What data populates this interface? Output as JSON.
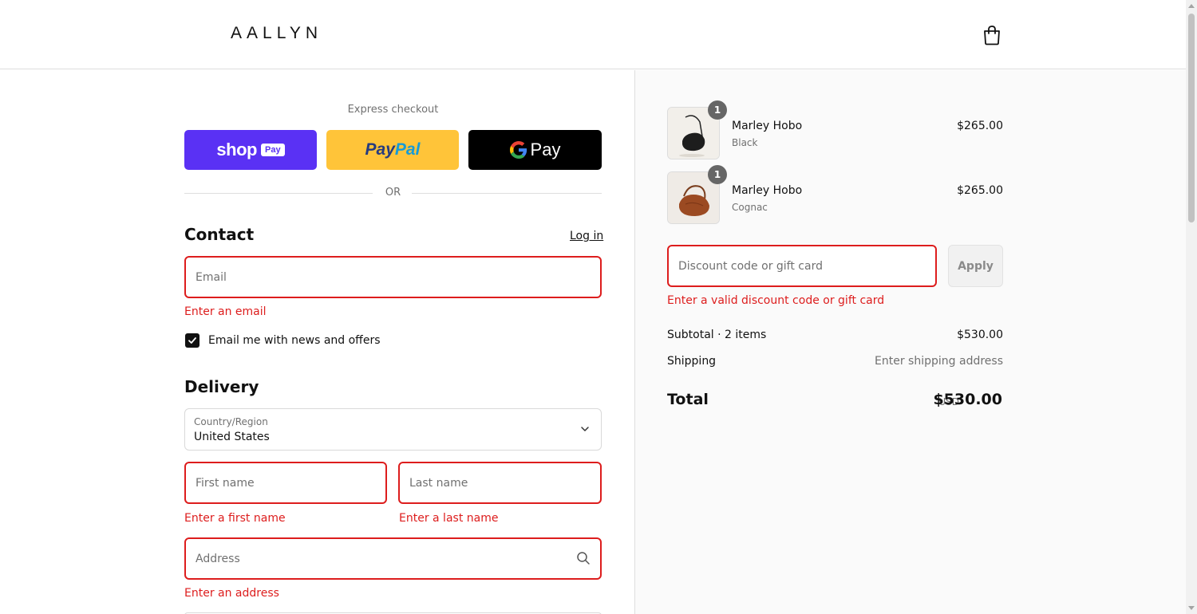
{
  "header": {
    "logo": "AALLYN",
    "cart_icon": "shopping-bag-icon"
  },
  "express": {
    "label": "Express checkout",
    "shop_pay": {
      "word": "shop",
      "pill": "Pay",
      "color": "#5a31f4"
    },
    "paypal": {
      "part1": "Pay",
      "part2": "Pal",
      "color": "#ffc439"
    },
    "gpay": {
      "g": "G",
      "word": "Pay",
      "color": "#000000"
    },
    "or_text": "OR"
  },
  "contact": {
    "title": "Contact",
    "login_label": "Log in",
    "email_placeholder": "Email",
    "email_error": "Enter an email",
    "newsletter_label": "Email me with news and offers",
    "newsletter_checked": true
  },
  "delivery": {
    "title": "Delivery",
    "country_label": "Country/Region",
    "country_value": "United States",
    "first_name_placeholder": "First name",
    "first_name_error": "Enter a first name",
    "last_name_placeholder": "Last name",
    "last_name_error": "Enter a last name",
    "address_placeholder": "Address",
    "address_error": "Enter an address"
  },
  "cart": {
    "items": [
      {
        "name": "Marley Hobo",
        "variant": "Black",
        "price": "$265.00",
        "qty": "1"
      },
      {
        "name": "Marley Hobo",
        "variant": "Cognac",
        "price": "$265.00",
        "qty": "1"
      }
    ],
    "discount_placeholder": "Discount code or gift card",
    "apply_label": "Apply",
    "discount_error": "Enter a valid discount code or gift card",
    "subtotal_label": "Subtotal · 2 items",
    "subtotal_value": "$530.00",
    "shipping_label": "Shipping",
    "shipping_value": "Enter shipping address",
    "total_label": "Total",
    "total_currency": "USD",
    "total_value": "$530.00"
  },
  "colors": {
    "error": "#dd1d1d",
    "accent": "#111111"
  }
}
